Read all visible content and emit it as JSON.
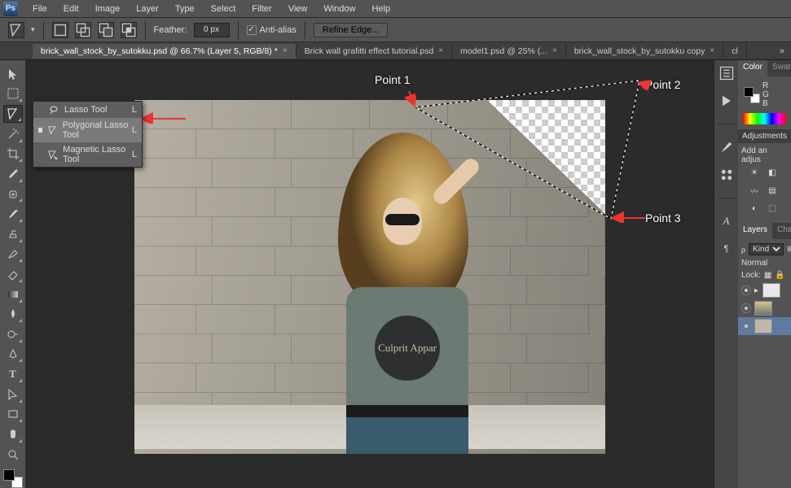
{
  "app": {
    "logo_text": "Ps"
  },
  "menu": [
    "File",
    "Edit",
    "Image",
    "Layer",
    "Type",
    "Select",
    "Filter",
    "View",
    "Window",
    "Help"
  ],
  "options": {
    "feather_label": "Feather:",
    "feather_value": "0 px",
    "antialias_label": "Anti-alias",
    "refine_label": "Refine Edge..."
  },
  "tabs": [
    {
      "label": "brick_wall_stock_by_sutokku.psd @ 66.7% (Layer 5, RGB/8) *",
      "active": true
    },
    {
      "label": "Brick wall grafitti effect tutorial.psd",
      "active": false
    },
    {
      "label": "model1.psd @ 25% (...",
      "active": false
    },
    {
      "label": "brick_wall_stock_by_sutokku copy",
      "active": false
    },
    {
      "label": "cl",
      "active": false
    }
  ],
  "lasso_flyout": {
    "items": [
      {
        "label": "Lasso Tool",
        "shortcut": "L",
        "selected": false
      },
      {
        "label": "Polygonal Lasso Tool",
        "shortcut": "L",
        "selected": true
      },
      {
        "label": "Magnetic Lasso Tool",
        "shortcut": "L",
        "selected": false
      }
    ]
  },
  "annotations": {
    "p1": "Point 1",
    "p2": "Point 2",
    "p3": "Point 3"
  },
  "shirt_logo": "Culprit\nAppar",
  "color_panel": {
    "tabs": [
      "Color",
      "Swat"
    ],
    "channels": [
      "R",
      "G",
      "B"
    ]
  },
  "adjustments": {
    "title": "Adjustments",
    "hint": "Add an adjus"
  },
  "layers_panel": {
    "tabs": [
      "Layers",
      "Chan"
    ],
    "kind_label": "Kind",
    "blend_mode": "Normal",
    "lock_label": "Lock:"
  }
}
